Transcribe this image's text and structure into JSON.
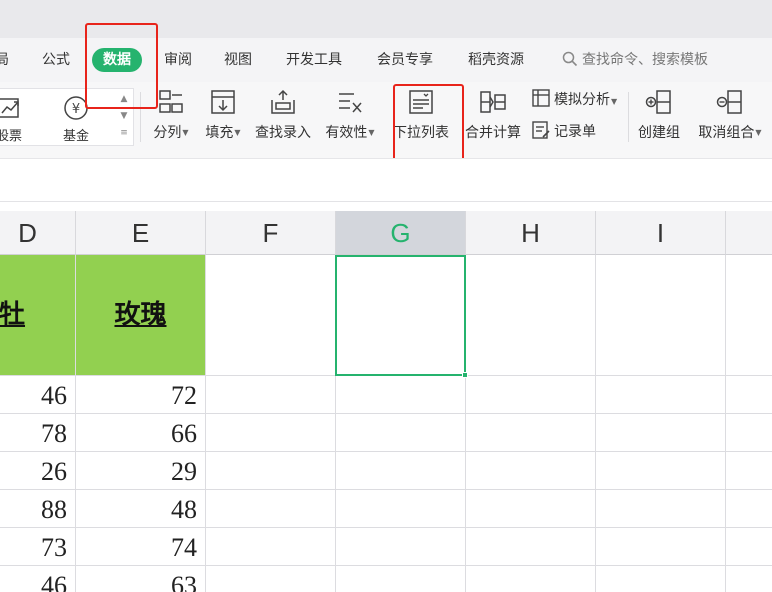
{
  "ribbon": {
    "tabs": [
      {
        "label": "局",
        "active": false
      },
      {
        "label": "公式",
        "active": false
      },
      {
        "label": "数据",
        "active": true
      },
      {
        "label": "审阅",
        "active": false
      },
      {
        "label": "视图",
        "active": false
      },
      {
        "label": "开发工具",
        "active": false
      },
      {
        "label": "会员专享",
        "active": false
      },
      {
        "label": "稻壳资源",
        "active": false
      }
    ],
    "search_placeholder": "查找命令、搜索模板"
  },
  "toolbar": {
    "gallery": [
      {
        "label": "股票",
        "icon": "stock-trend-icon"
      },
      {
        "label": "基金",
        "icon": "yen-fund-icon"
      }
    ],
    "buttons": [
      {
        "label": "分列",
        "icon": "split-column-icon",
        "has_dropdown": true
      },
      {
        "label": "填充",
        "icon": "fill-down-icon",
        "has_dropdown": true
      },
      {
        "label": "查找录入",
        "icon": "find-entry-icon",
        "has_dropdown": false
      },
      {
        "label": "有效性",
        "icon": "validation-icon",
        "has_dropdown": true
      },
      {
        "label": "下拉列表",
        "icon": "dropdown-list-icon",
        "has_dropdown": false
      },
      {
        "label": "合并计算",
        "icon": "consolidate-icon",
        "has_dropdown": false
      }
    ],
    "small_buttons": [
      {
        "label": "模拟分析",
        "icon": "what-if-analysis-icon",
        "has_dropdown": true
      },
      {
        "label": "记录单",
        "icon": "record-form-icon",
        "has_dropdown": false
      }
    ],
    "group_buttons": [
      {
        "label": "创建组",
        "icon": "group-icon",
        "has_dropdown": false
      },
      {
        "label": "取消组合",
        "icon": "ungroup-icon",
        "has_dropdown": true
      }
    ]
  },
  "sheet": {
    "columns": [
      "D",
      "E",
      "F",
      "G",
      "H",
      "I"
    ],
    "selected_column": "G",
    "header_row": {
      "D": "牡",
      "E": "玫瑰"
    },
    "rows": [
      {
        "D": "46",
        "E": "72"
      },
      {
        "D": "78",
        "E": "66"
      },
      {
        "D": "26",
        "E": "29"
      },
      {
        "D": "88",
        "E": "48"
      },
      {
        "D": "73",
        "E": "74"
      },
      {
        "D": "46",
        "E": "63"
      }
    ]
  },
  "colors": {
    "accent": "#25b36e",
    "header_fill": "#92d050",
    "highlight_box": "#e8241b"
  }
}
